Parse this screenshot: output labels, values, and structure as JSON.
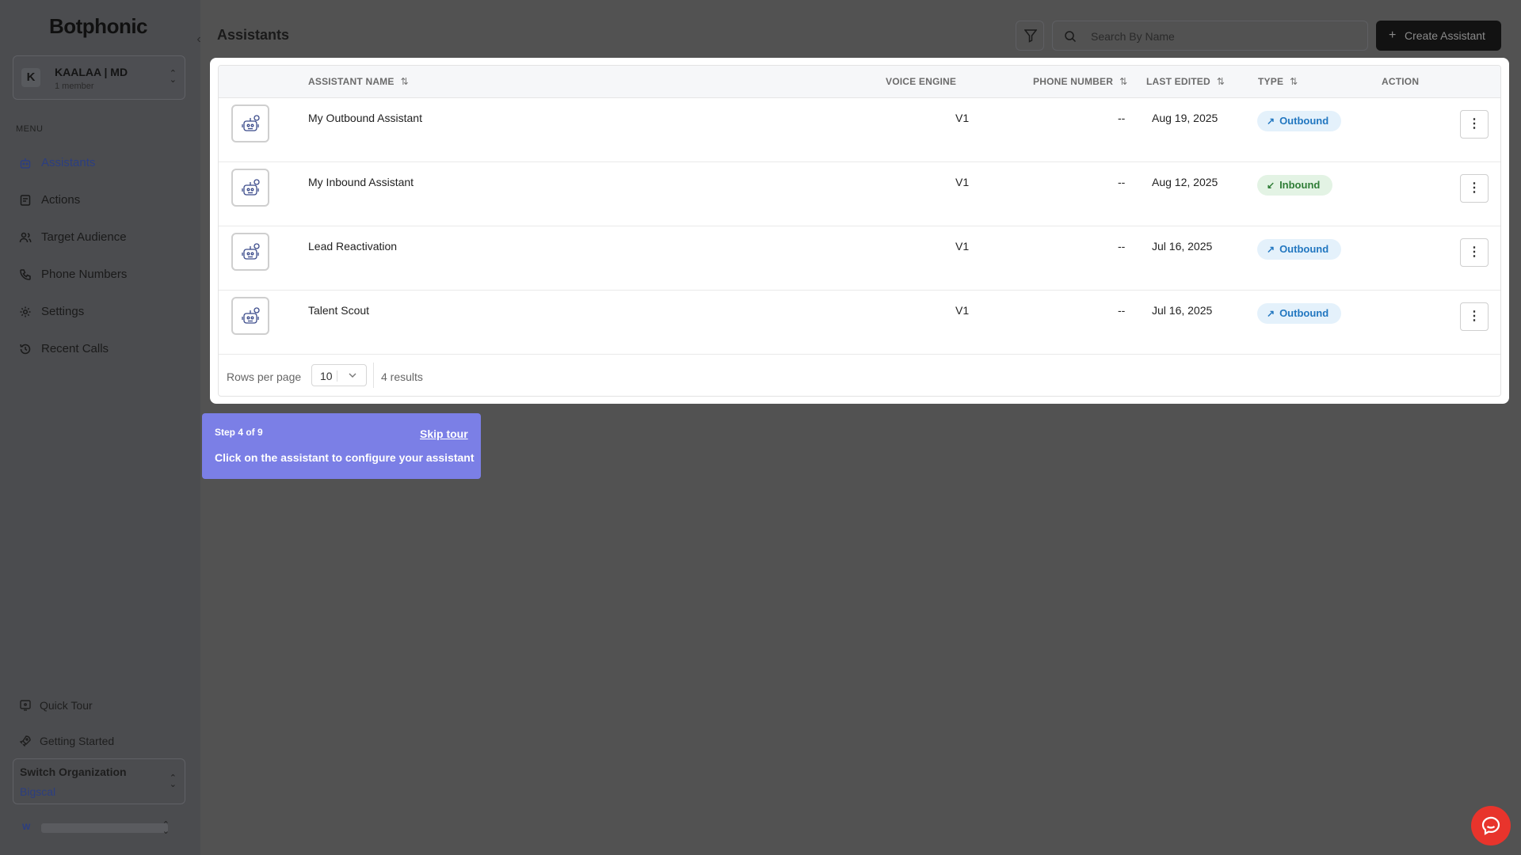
{
  "sidebar": {
    "logo": "Botphonic",
    "org": {
      "initial": "K",
      "name": "KAALAA | MD",
      "members": "1 member"
    },
    "menu_label": "MENU",
    "items": [
      {
        "label": "Assistants",
        "icon": "robot-icon",
        "active": true
      },
      {
        "label": "Actions",
        "icon": "actions-icon"
      },
      {
        "label": "Target Audience",
        "icon": "users-icon"
      },
      {
        "label": "Phone Numbers",
        "icon": "phone-icon"
      },
      {
        "label": "Settings",
        "icon": "gear-icon"
      },
      {
        "label": "Recent Calls",
        "icon": "history-icon"
      }
    ],
    "quick_tour": "Quick Tour",
    "getting_started": "Getting Started",
    "switch_org": {
      "title": "Switch Organization",
      "value": "Bigscal"
    },
    "user_initial": "W"
  },
  "header": {
    "title": "Assistants",
    "search_placeholder": "Search By Name",
    "create_label": "Create Assistant"
  },
  "table": {
    "columns": {
      "name": "ASSISTANT NAME",
      "voice": "VOICE ENGINE",
      "phone": "PHONE NUMBER",
      "edited": "LAST EDITED",
      "type": "TYPE",
      "action": "ACTION"
    },
    "rows": [
      {
        "name": "My Outbound Assistant",
        "voice": "V1",
        "phone": "--",
        "edited": "Aug 19, 2025",
        "type": "Outbound",
        "type_arrow": "↗"
      },
      {
        "name": "My Inbound Assistant",
        "voice": "V1",
        "phone": "--",
        "edited": "Aug 12, 2025",
        "type": "Inbound",
        "type_arrow": "↙"
      },
      {
        "name": "Lead Reactivation",
        "voice": "V1",
        "phone": "--",
        "edited": "Jul 16, 2025",
        "type": "Outbound",
        "type_arrow": "↗"
      },
      {
        "name": "Talent Scout",
        "voice": "V1",
        "phone": "--",
        "edited": "Jul 16, 2025",
        "type": "Outbound",
        "type_arrow": "↗"
      }
    ],
    "footer": {
      "rows_per_page_label": "Rows per page",
      "rows_per_page": "10",
      "results": "4 results"
    }
  },
  "tour": {
    "step": "Step 4 of 9",
    "skip": "Skip tour",
    "message": "Click on the assistant to configure your assistant"
  },
  "colors": {
    "accent": "#7b7fe6",
    "outbound_bg": "#e4f1fb",
    "outbound_fg": "#2277c0",
    "inbound_bg": "#e3f3e4",
    "inbound_fg": "#2f7d36",
    "chat": "#e8342c"
  }
}
